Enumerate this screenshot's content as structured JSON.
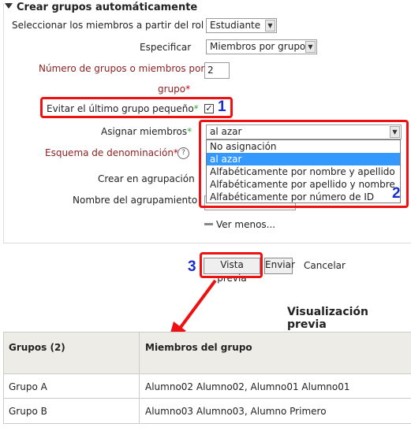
{
  "legend": "Crear grupos automáticamente",
  "fields": {
    "role_label": "Seleccionar los miembros a partir del rol",
    "role_value": "Estudiante",
    "specify_label": "Especificar",
    "specify_value": "Miembros por grupo",
    "number_label_1": "Número de grupos o miembros por",
    "number_label_2": "grupo",
    "number_value": "2",
    "avoid_label": "Evitar el último grupo pequeño",
    "assign_label": "Asignar miembros",
    "assign_value": "al azar",
    "naming_label": "Esquema de denominación",
    "create_grouping_label": "Crear en agrupación",
    "grouping_name_label": "Nombre del agrupamiento",
    "show_less": "Ver menos..."
  },
  "dropdown_options": [
    "No asignación",
    "al azar",
    "Alfabéticamente por nombre y apellido",
    "Alfabéticamente por apellido y nombre",
    "Alfabéticamente por número de ID"
  ],
  "buttons": {
    "preview": "Vista previa",
    "submit": "Enviar",
    "cancel": "Cancelar"
  },
  "annotations": {
    "n1": "1",
    "n2": "2",
    "n3": "3"
  },
  "preview": {
    "title": "Visualización previa",
    "col_groups": "Grupos (2)",
    "col_members": "Miembros del grupo",
    "rows": [
      {
        "group": "Grupo A",
        "members": "Alumno02 Alumno02, Alumno01 Alumno01"
      },
      {
        "group": "Grupo B",
        "members": "Alumno03 Alumno03, Alumno Primero"
      }
    ]
  },
  "colors": {
    "annotation_red": "#e11111",
    "annotation_blue": "#1a2dd1",
    "selection_blue": "#3399ff"
  }
}
